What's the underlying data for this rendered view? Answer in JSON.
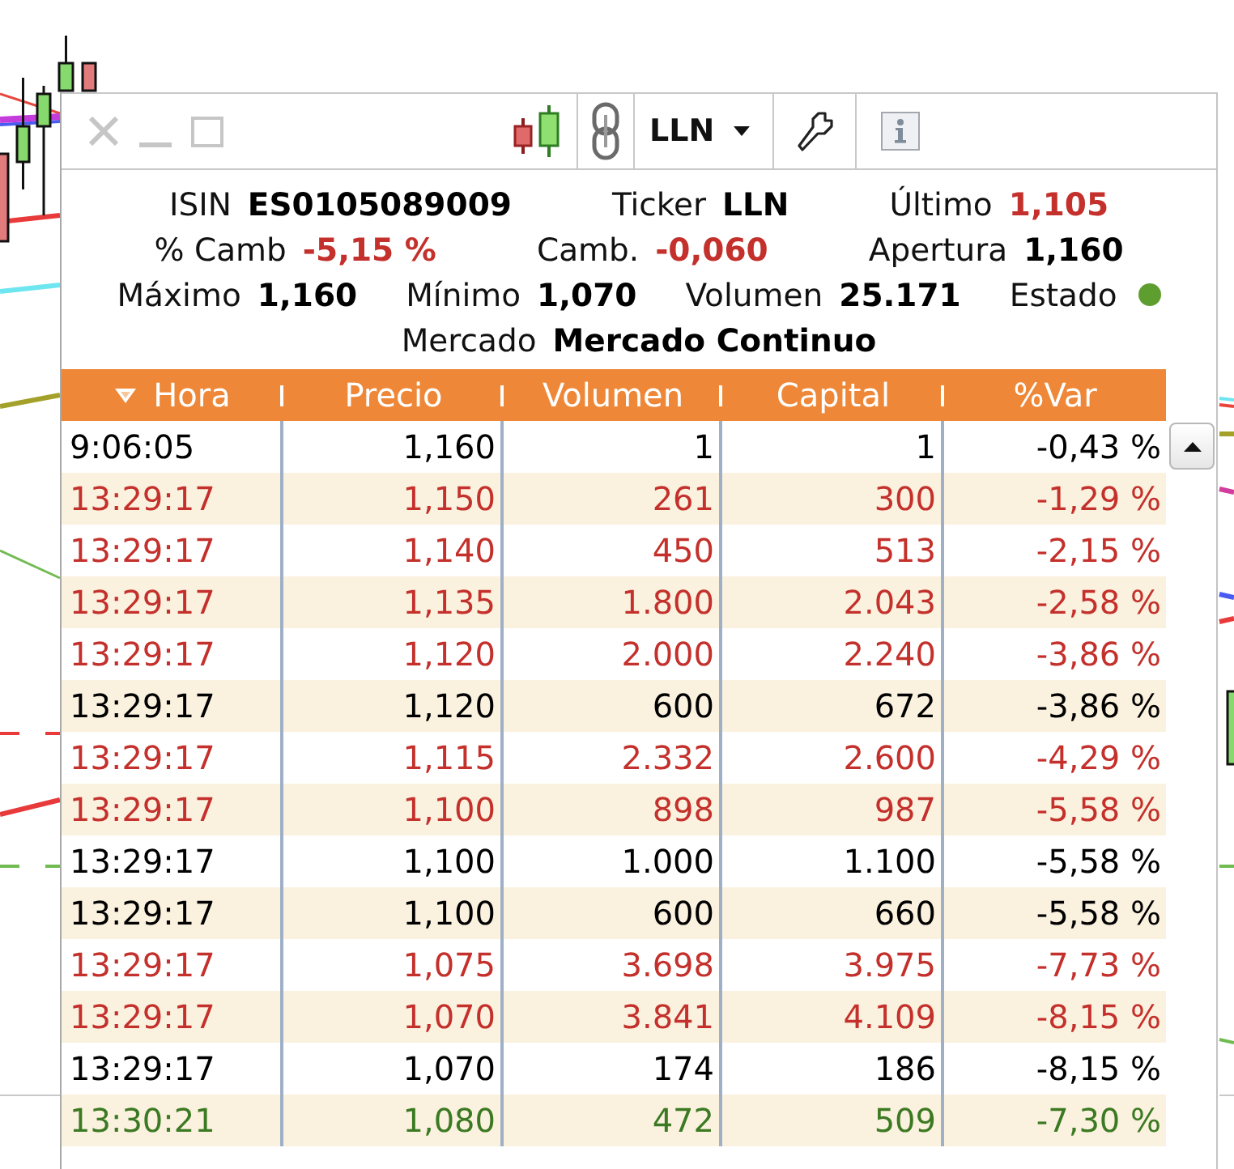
{
  "toolbar": {
    "ticker": "LLN"
  },
  "quote": {
    "lines": [
      {
        "fields": [
          {
            "kind": "text",
            "label": "ISIN",
            "value": "ES0105089009",
            "color": "#000000"
          },
          {
            "kind": "text",
            "label": "Ticker",
            "value": "LLN",
            "color": "#000000"
          },
          {
            "kind": "text",
            "label": "Último",
            "value": "1,105",
            "color": "#c4302b"
          }
        ]
      },
      {
        "fields": [
          {
            "kind": "text",
            "label": "% Camb",
            "value": "-5,15 %",
            "color": "#c4302b"
          },
          {
            "kind": "text",
            "label": "Camb.",
            "value": "-0,060",
            "color": "#c4302b"
          },
          {
            "kind": "text",
            "label": "Apertura",
            "value": "1,160",
            "color": "#000000"
          }
        ]
      },
      {
        "fields": [
          {
            "kind": "text",
            "label": "Máximo",
            "value": "1,160",
            "color": "#000000"
          },
          {
            "kind": "text",
            "label": "Mínimo",
            "value": "1,070",
            "color": "#000000"
          },
          {
            "kind": "text",
            "label": "Volumen",
            "value": "25.171",
            "color": "#000000"
          },
          {
            "kind": "status",
            "label": "Estado",
            "color": "#5e9e2e"
          }
        ]
      },
      {
        "fields": [
          {
            "kind": "text",
            "label": "Mercado",
            "value": "Mercado Continuo",
            "color": "#000000"
          }
        ]
      }
    ]
  },
  "table": {
    "columns": [
      {
        "label": "Hora",
        "sorted": true
      },
      {
        "label": "Precio",
        "sorted": false
      },
      {
        "label": "Volumen",
        "sorted": false
      },
      {
        "label": "Capital",
        "sorted": false
      },
      {
        "label": "%Var",
        "sorted": false
      }
    ],
    "rows": [
      {
        "cells": [
          "9:06:05",
          "1,160",
          "1",
          "1",
          "-0,43 %"
        ],
        "color": "#000000"
      },
      {
        "cells": [
          "13:29:17",
          "1,150",
          "261",
          "300",
          "-1,29 %"
        ],
        "color": "#c4302b"
      },
      {
        "cells": [
          "13:29:17",
          "1,140",
          "450",
          "513",
          "-2,15 %"
        ],
        "color": "#c4302b"
      },
      {
        "cells": [
          "13:29:17",
          "1,135",
          "1.800",
          "2.043",
          "-2,58 %"
        ],
        "color": "#c4302b"
      },
      {
        "cells": [
          "13:29:17",
          "1,120",
          "2.000",
          "2.240",
          "-3,86 %"
        ],
        "color": "#c4302b"
      },
      {
        "cells": [
          "13:29:17",
          "1,120",
          "600",
          "672",
          "-3,86 %"
        ],
        "color": "#000000"
      },
      {
        "cells": [
          "13:29:17",
          "1,115",
          "2.332",
          "2.600",
          "-4,29 %"
        ],
        "color": "#c4302b"
      },
      {
        "cells": [
          "13:29:17",
          "1,100",
          "898",
          "987",
          "-5,58 %"
        ],
        "color": "#c4302b"
      },
      {
        "cells": [
          "13:29:17",
          "1,100",
          "1.000",
          "1.100",
          "-5,58 %"
        ],
        "color": "#000000"
      },
      {
        "cells": [
          "13:29:17",
          "1,100",
          "600",
          "660",
          "-5,58 %"
        ],
        "color": "#000000"
      },
      {
        "cells": [
          "13:29:17",
          "1,075",
          "3.698",
          "3.975",
          "-7,73 %"
        ],
        "color": "#c4302b"
      },
      {
        "cells": [
          "13:29:17",
          "1,070",
          "3.841",
          "4.109",
          "-8,15 %"
        ],
        "color": "#c4302b"
      },
      {
        "cells": [
          "13:29:17",
          "1,070",
          "174",
          "186",
          "-8,15 %"
        ],
        "color": "#000000"
      },
      {
        "cells": [
          "13:30:21",
          "1,080",
          "472",
          "509",
          "-7,30 %"
        ],
        "color": "#3b7a22"
      }
    ]
  }
}
